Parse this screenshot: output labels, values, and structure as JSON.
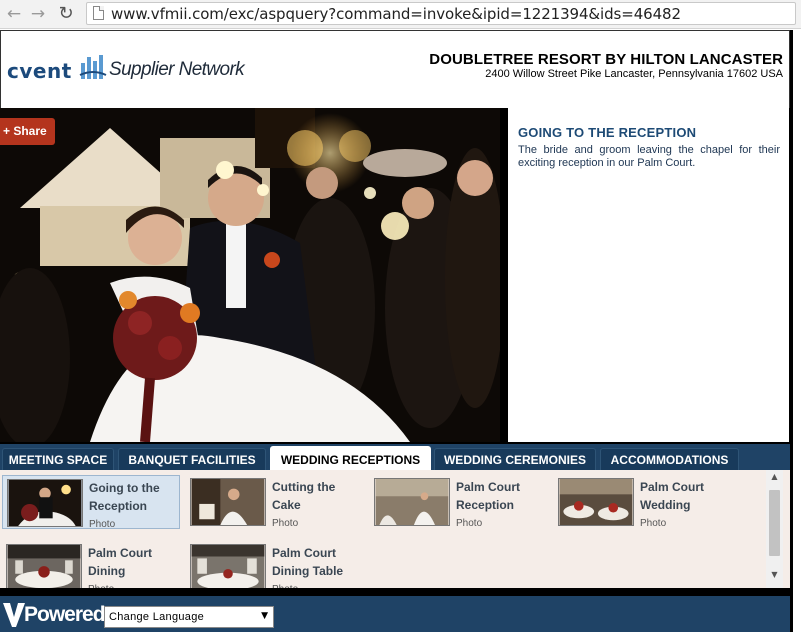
{
  "browser": {
    "back_icon": "back-arrow-icon",
    "forward_icon": "forward-arrow-icon",
    "reload_icon": "reload-icon",
    "url": "www.vfmii.com/exc/aspquery?command=invoke&ipid=1221394&ids=46482"
  },
  "header": {
    "logo_brand": "cvent",
    "logo_subtitle": "Supplier Network",
    "hotel_name": "DOUBLETREE RESORT BY HILTON LANCASTER",
    "hotel_address": "2400 Willow Street Pike Lancaster, Pennsylvania 17602 USA"
  },
  "photo": {
    "share_label": "+ Share"
  },
  "info": {
    "title": "GOING TO THE RECEPTION",
    "description": "The bride and groom leaving the chapel for their exciting reception in our Palm Court."
  },
  "tabs": [
    {
      "label": "MEETING SPACE",
      "active": false
    },
    {
      "label": "BANQUET FACILITIES",
      "active": false
    },
    {
      "label": "WEDDING RECEPTIONS",
      "active": true
    },
    {
      "label": "WEDDING CEREMONIES",
      "active": false
    },
    {
      "label": "ACCOMMODATIONS",
      "active": false
    }
  ],
  "gallery": {
    "items": [
      {
        "title": "Going to the Reception",
        "type": "Photo",
        "selected": true
      },
      {
        "title": "Cutting the Cake",
        "type": "Photo",
        "selected": false
      },
      {
        "title": "Palm Court Reception",
        "type": "Photo",
        "selected": false
      },
      {
        "title": "Palm Court Wedding",
        "type": "Photo",
        "selected": false
      },
      {
        "title": "Palm Court Dining",
        "type": "Photo",
        "selected": false
      },
      {
        "title": "Palm Court Dining Table",
        "type": "Photo",
        "selected": false
      }
    ]
  },
  "footer": {
    "powered_text": "Powered",
    "language_select": "Change Language"
  },
  "colors": {
    "navy": "#1f4366",
    "title_blue": "#1d4a75",
    "share_red": "#b4341d",
    "gallery_bg": "#f5ede8"
  }
}
